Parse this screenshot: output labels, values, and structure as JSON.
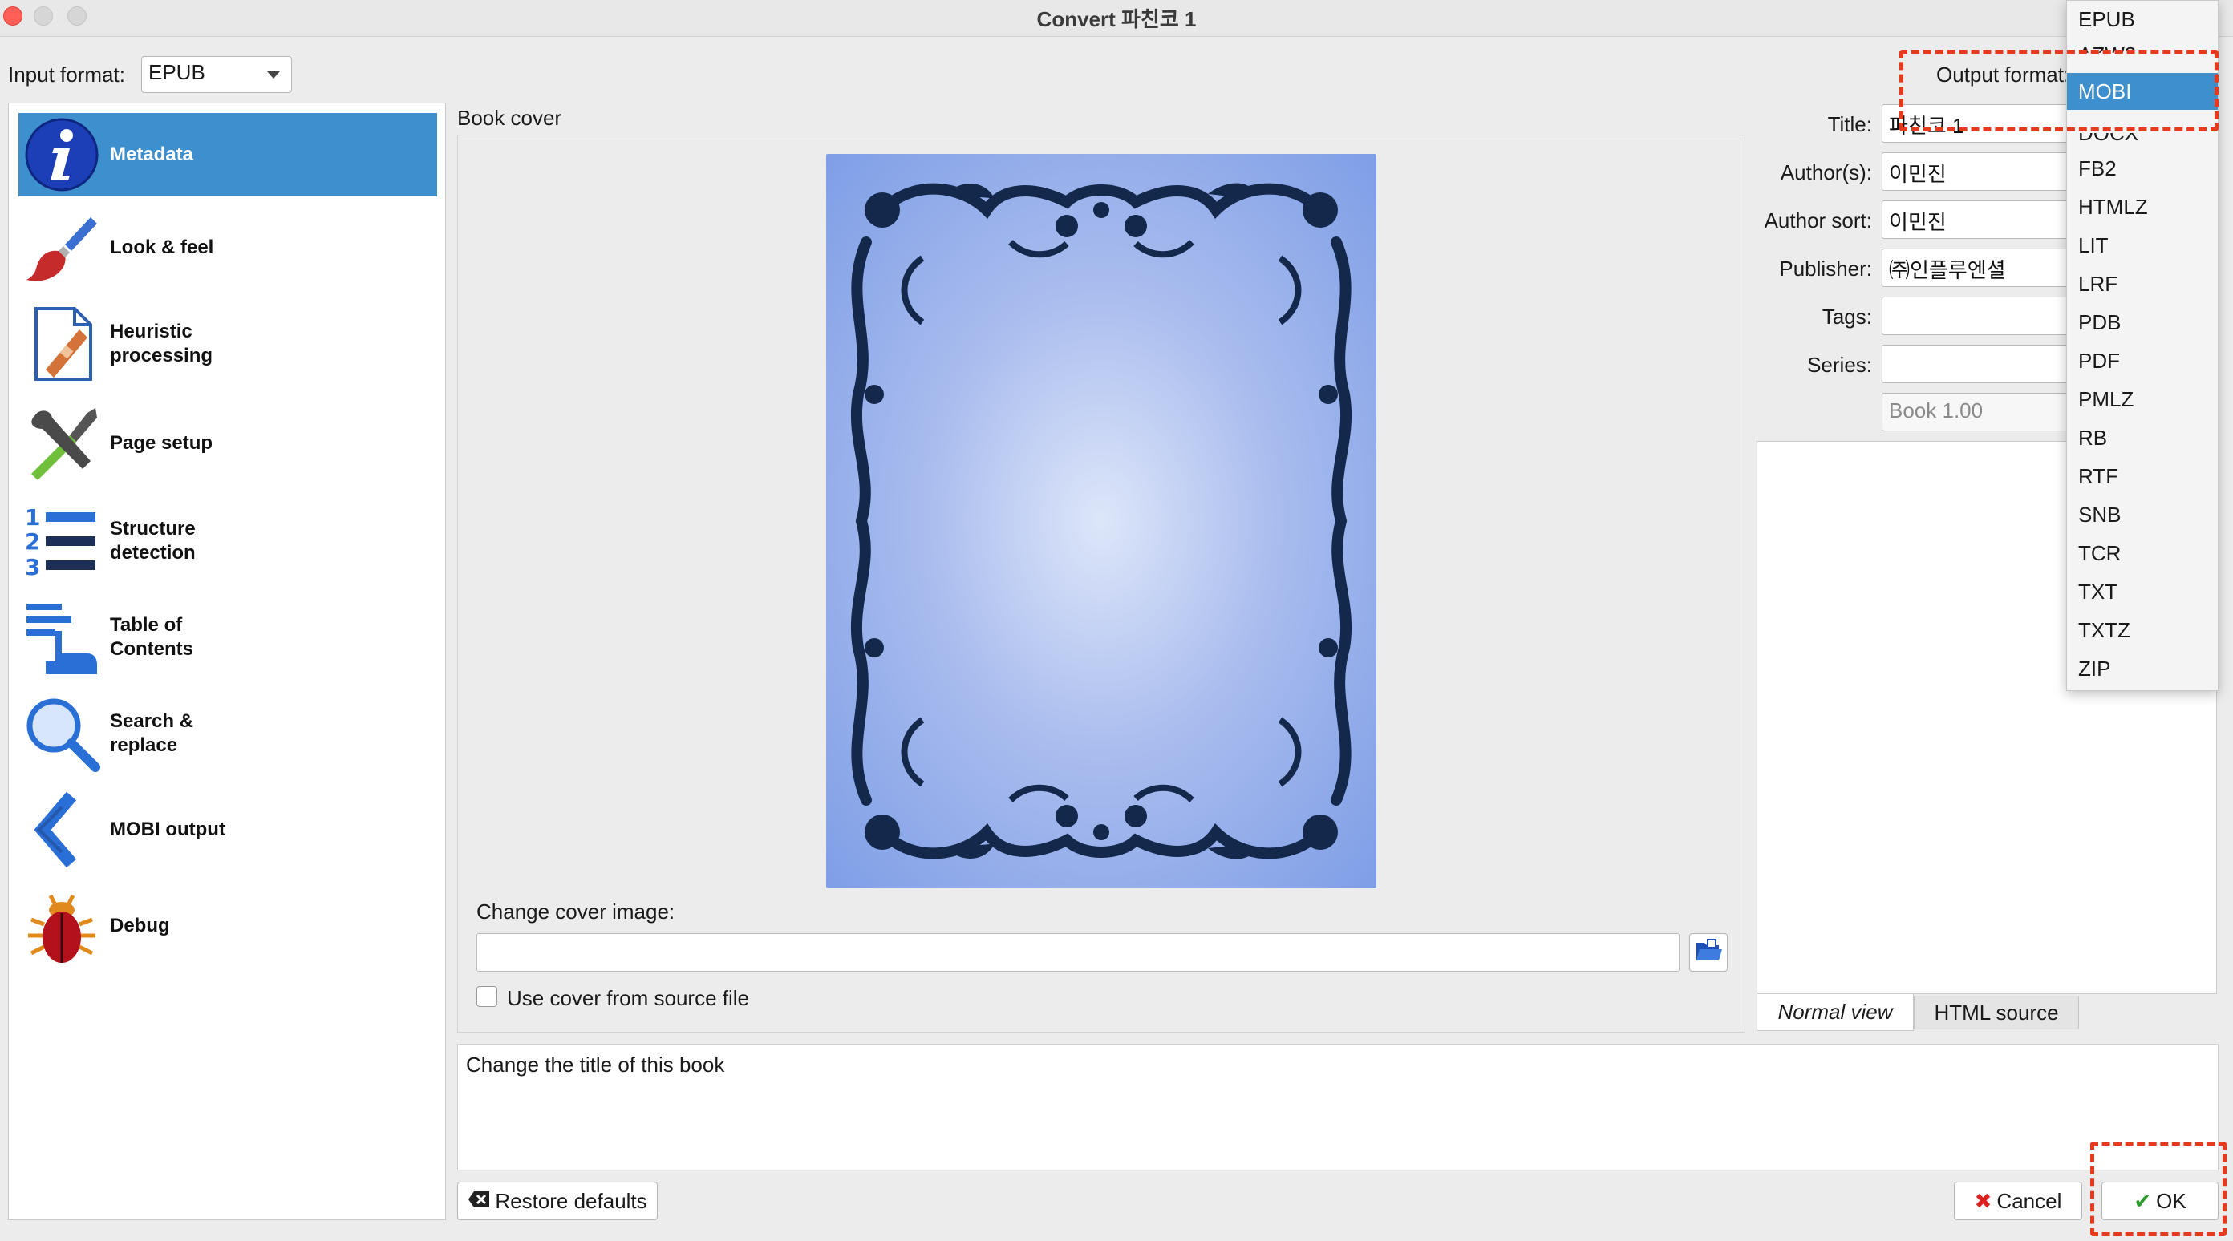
{
  "window": {
    "title": "Convert 파친코 1"
  },
  "input_format": {
    "label": "Input format:",
    "value": "EPUB"
  },
  "output_format": {
    "label": "Output format:"
  },
  "sidebar": {
    "items": [
      {
        "label": "Metadata",
        "icon": "info-icon",
        "selected": true
      },
      {
        "label": "Look & feel",
        "icon": "paintbrush-icon"
      },
      {
        "label": "Heuristic processing",
        "icon": "document-bandage-icon"
      },
      {
        "label": "Page setup",
        "icon": "tools-icon"
      },
      {
        "label": "Structure detection",
        "icon": "numbered-list-icon"
      },
      {
        "label": "Table of Contents",
        "icon": "toc-hand-icon"
      },
      {
        "label": "Search & replace",
        "icon": "magnifier-icon"
      },
      {
        "label": "MOBI output",
        "icon": "chevron-left-icon"
      },
      {
        "label": "Debug",
        "icon": "bug-icon"
      }
    ]
  },
  "cover": {
    "heading": "Book cover",
    "change_label": "Change cover image:",
    "path_value": "",
    "use_source_label": "Use cover from source file",
    "use_source_checked": false
  },
  "metadata": {
    "title_label": "Title:",
    "title_value": "파친코 1",
    "authors_label": "Author(s):",
    "authors_value": "이민진",
    "author_sort_label": "Author sort:",
    "author_sort_value": "이민진",
    "publisher_label": "Publisher:",
    "publisher_value": "㈜인플루엔셜",
    "tags_label": "Tags:",
    "tags_value": "",
    "series_label": "Series:",
    "series_value": "",
    "series_index": "Book 1.00"
  },
  "comments": {
    "tab_normal": "Normal view",
    "tab_html": "HTML source"
  },
  "description": "Change the title of this book",
  "buttons": {
    "restore": "Restore defaults",
    "cancel": "Cancel",
    "ok": "OK"
  },
  "format_dropdown": {
    "options": [
      "EPUB",
      "AZW3",
      "MOBI",
      "DOCX",
      "FB2",
      "HTMLZ",
      "LIT",
      "LRF",
      "PDB",
      "PDF",
      "PMLZ",
      "RB",
      "RTF",
      "SNB",
      "TCR",
      "TXT",
      "TXTZ",
      "ZIP"
    ],
    "selected": "MOBI"
  },
  "colors": {
    "selection": "#3d8fce",
    "highlight": "#e53a1e",
    "cover_ornament": "#13284a"
  }
}
